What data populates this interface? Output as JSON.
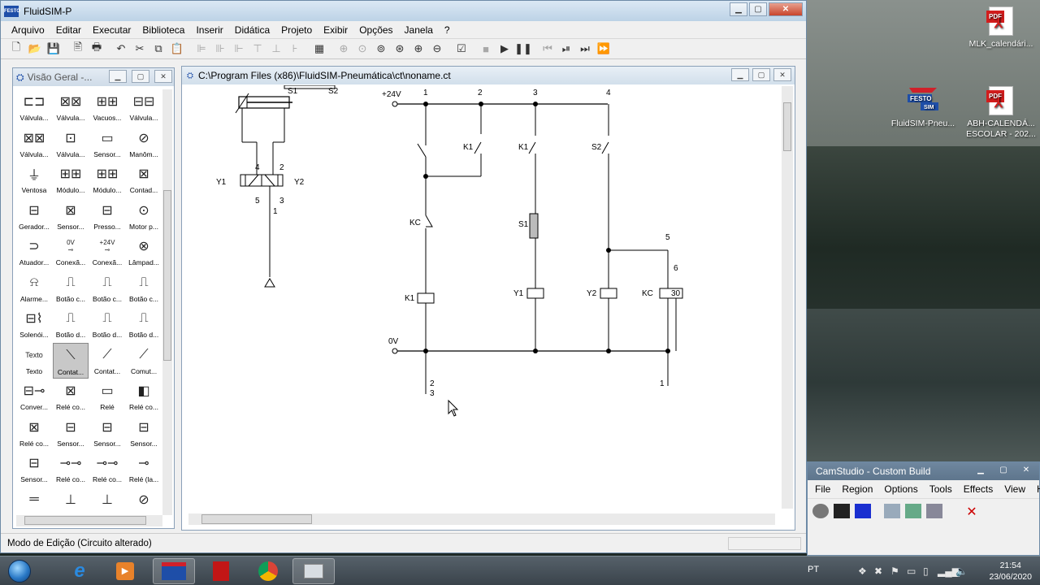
{
  "app": {
    "title": "FluidSIM-P",
    "icon_text": "FESTO"
  },
  "menu": [
    "Arquivo",
    "Editar",
    "Executar",
    "Biblioteca",
    "Inserir",
    "Didática",
    "Projeto",
    "Exibir",
    "Opções",
    "Janela",
    "?"
  ],
  "overview": {
    "title": "Visão Geral -...",
    "items": [
      {
        "label": "Válvula..."
      },
      {
        "label": "Válvula..."
      },
      {
        "label": "Vacuos..."
      },
      {
        "label": "Válvula..."
      },
      {
        "label": "Válvula..."
      },
      {
        "label": "Válvula..."
      },
      {
        "label": "Sensor..."
      },
      {
        "label": "Manôm..."
      },
      {
        "label": "Ventosa"
      },
      {
        "label": "Módulo..."
      },
      {
        "label": "Módulo..."
      },
      {
        "label": "Contad..."
      },
      {
        "label": "Gerador..."
      },
      {
        "label": "Sensor..."
      },
      {
        "label": "Presso..."
      },
      {
        "label": "Motor p..."
      },
      {
        "label": "Atuador..."
      },
      {
        "label": "Conexã..."
      },
      {
        "label": "Conexã..."
      },
      {
        "label": "Lâmpad..."
      },
      {
        "label": "Alarme..."
      },
      {
        "label": "Botão c..."
      },
      {
        "label": "Botão c..."
      },
      {
        "label": "Botão c..."
      },
      {
        "label": "Solenói..."
      },
      {
        "label": "Botão d..."
      },
      {
        "label": "Botão d..."
      },
      {
        "label": "Botão d..."
      },
      {
        "label": "Texto"
      },
      {
        "label": "Contat..."
      },
      {
        "label": "Contat..."
      },
      {
        "label": "Comut..."
      },
      {
        "label": "Conver..."
      },
      {
        "label": "Relé co..."
      },
      {
        "label": "Relé"
      },
      {
        "label": "Relé co..."
      },
      {
        "label": "Relé co..."
      },
      {
        "label": "Sensor..."
      },
      {
        "label": "Sensor..."
      },
      {
        "label": "Sensor..."
      },
      {
        "label": "Sensor..."
      },
      {
        "label": "Relé co..."
      },
      {
        "label": "Relé co..."
      },
      {
        "label": "Relé (la..."
      },
      {
        "label": ""
      },
      {
        "label": ""
      },
      {
        "label": ""
      },
      {
        "label": ""
      }
    ],
    "inline_texts": {
      "zero_v": "0V",
      "plus24v": "+24V",
      "texto_symbol": "Texto"
    }
  },
  "circuit_window": {
    "title": "C:\\Program Files (x86)\\FluidSIM-Pneumática\\ct\\noname.ct",
    "labels": {
      "s1_top": "S1",
      "s2_top": "S2",
      "port4": "4",
      "port2": "2",
      "port5": "5",
      "port3": "3",
      "port1": "1",
      "y1_valve": "Y1",
      "y2_valve": "Y2",
      "plus24v": "+24V",
      "zero_v": "0V",
      "col1": "1",
      "col2": "2",
      "col3": "3",
      "col4": "4",
      "node5": "5",
      "node6": "6",
      "k1_a": "K1",
      "k1_b": "K1",
      "s2": "S2",
      "s1": "S1",
      "kc_a": "KC",
      "kc_b": "KC",
      "k1_coil": "K1",
      "y1_coil": "Y1",
      "y2_coil": "Y2",
      "timer": "30",
      "bottom_2": "2",
      "bottom_3": "3",
      "bottom_1": "1"
    }
  },
  "status": "Modo de Edição (Circuito alterado)",
  "desktop_icons": [
    {
      "label": "MLK_calendári..."
    },
    {
      "label": "FluidSIM-Pneu..."
    },
    {
      "label": "ABH-CALENDÁ... ESCOLAR - 202..."
    }
  ],
  "camstudio": {
    "title": "CamStudio - Custom Build",
    "menu": [
      "File",
      "Region",
      "Options",
      "Tools",
      "Effects",
      "View",
      "Help"
    ]
  },
  "taskbar": {
    "lang": "PT",
    "time": "21:54",
    "date": "23/06/2020"
  },
  "icons": {
    "pdf_tag": "PDF",
    "sim_tag": "SIM",
    "festo_tag": "FESTO"
  }
}
